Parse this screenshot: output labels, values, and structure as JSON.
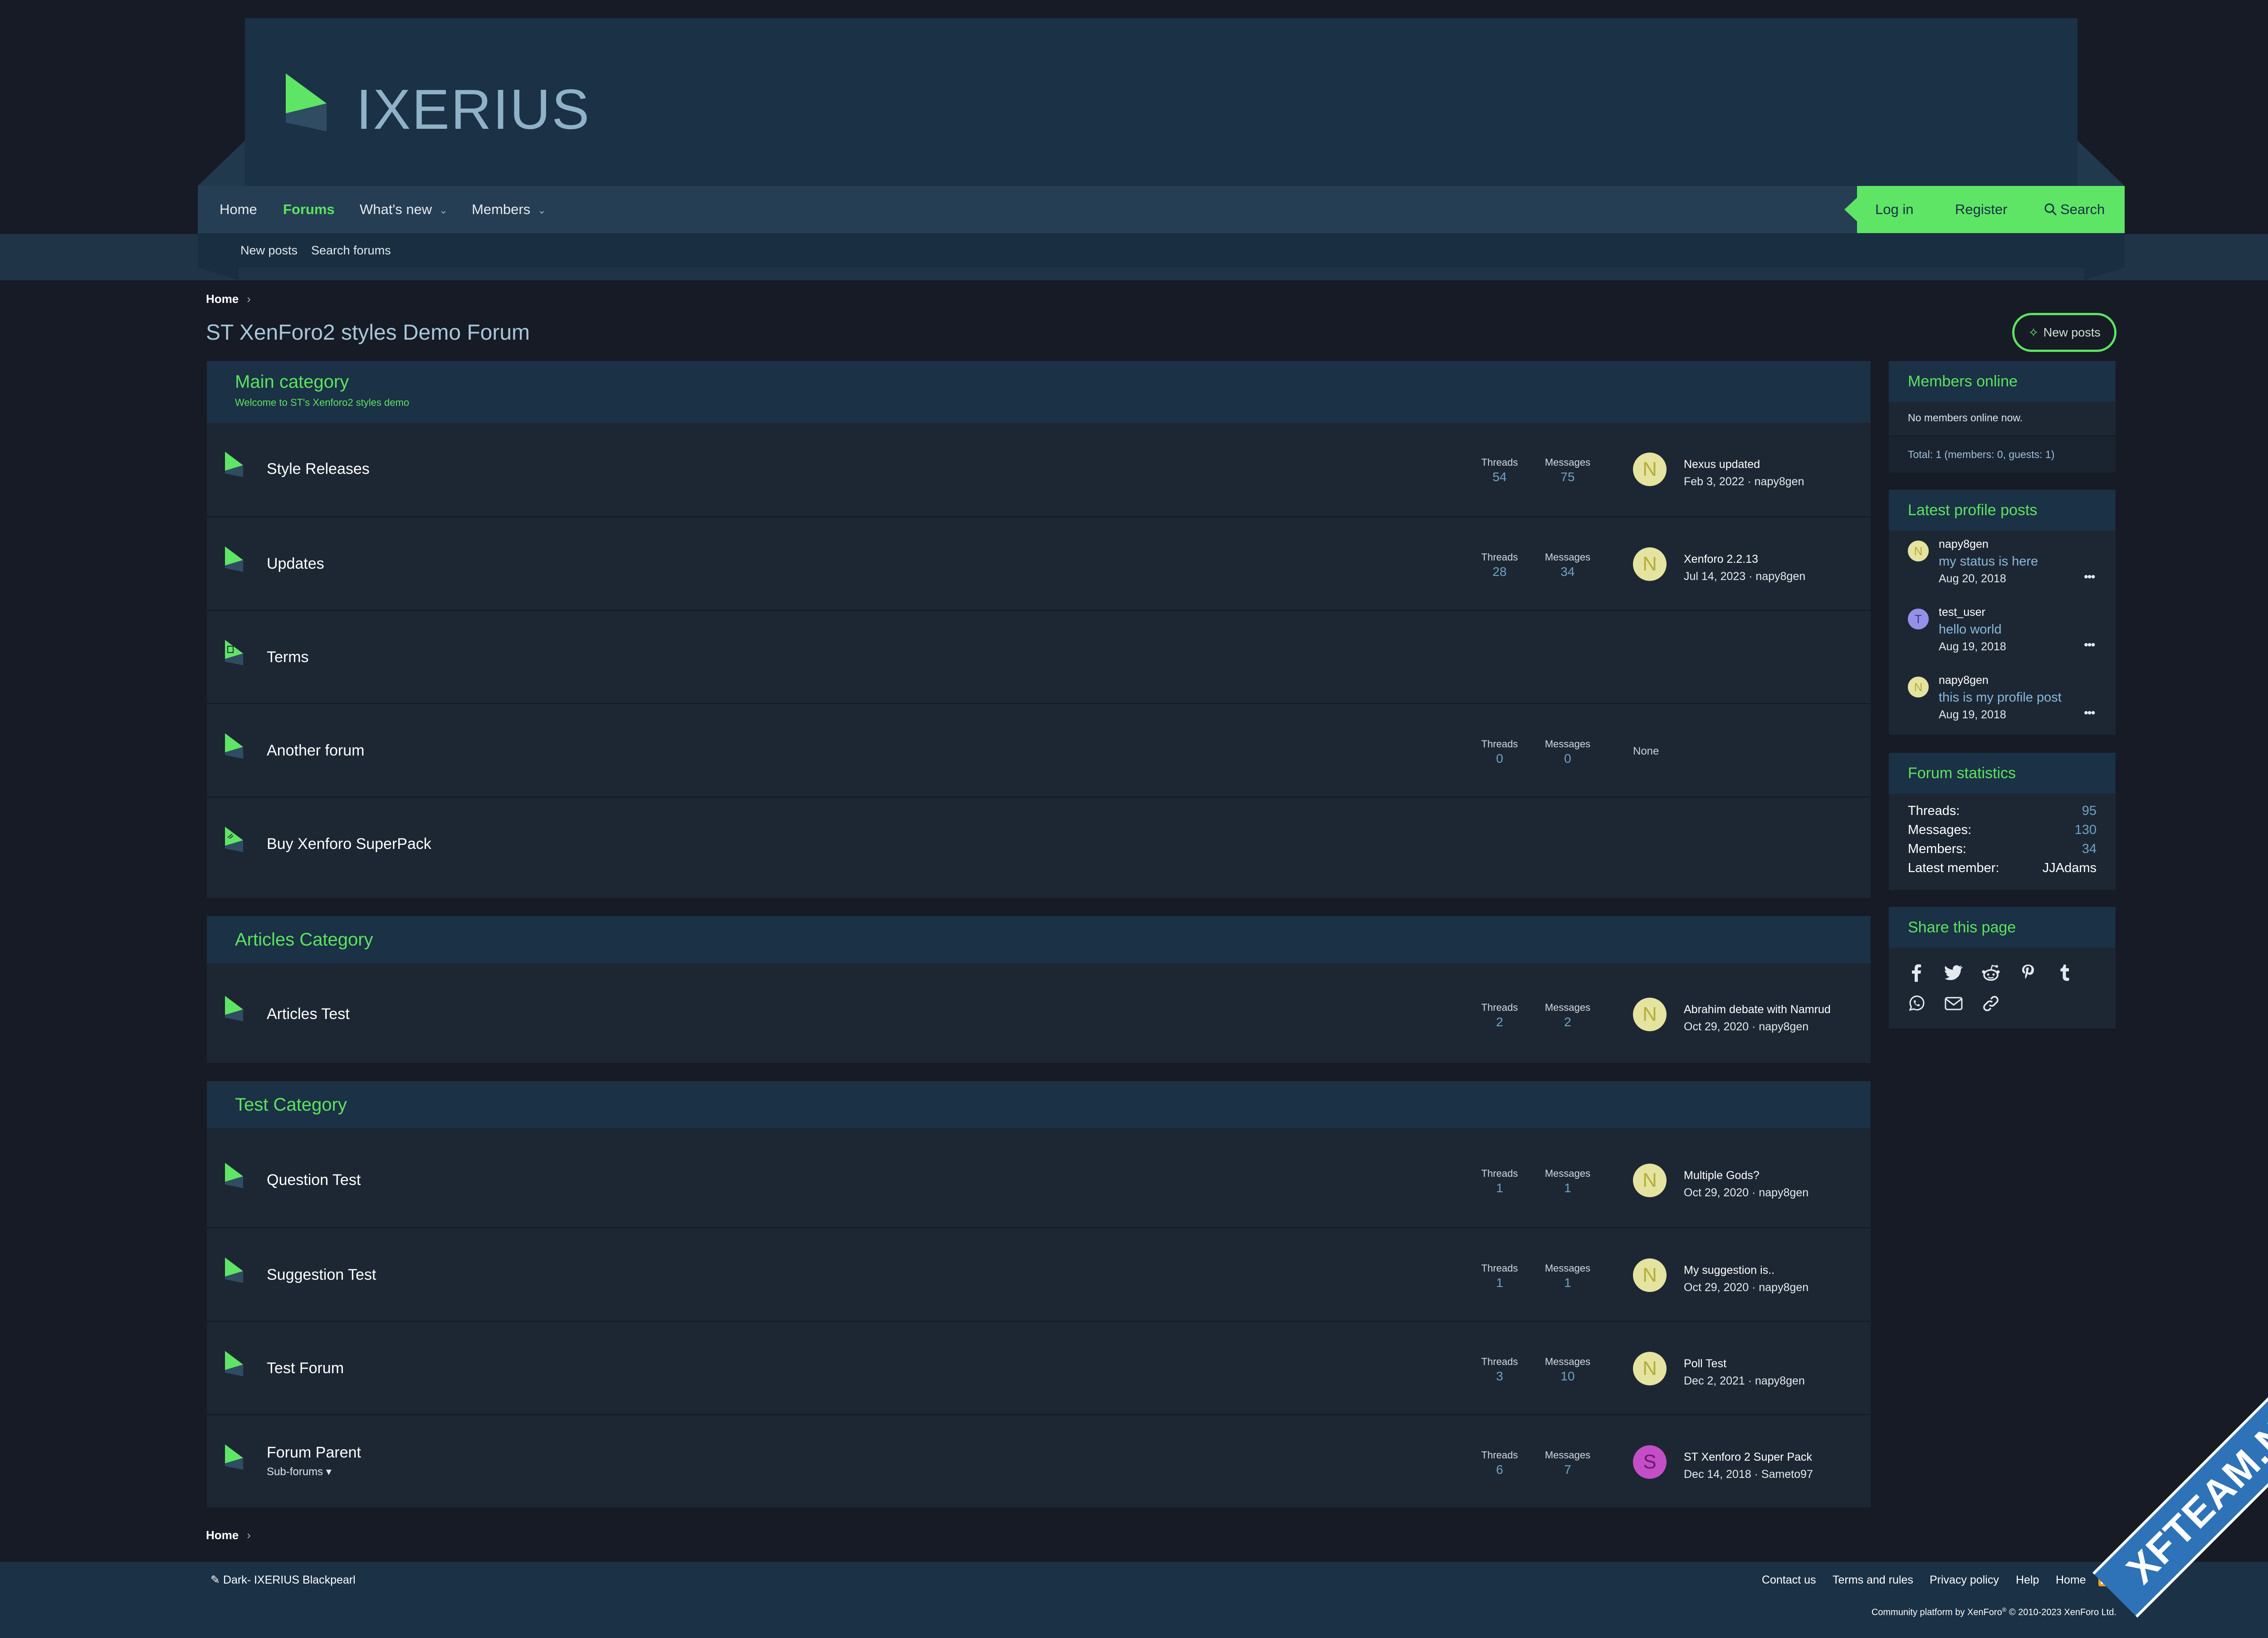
{
  "brand": {
    "logo_text": "IXERIUS"
  },
  "nav": {
    "items": [
      {
        "label": "Home"
      },
      {
        "label": "Forums"
      },
      {
        "label": "What's new"
      },
      {
        "label": "Members"
      }
    ],
    "login": "Log in",
    "register": "Register",
    "search": "Search",
    "sub_items": [
      {
        "label": "New posts"
      },
      {
        "label": "Search forums"
      }
    ]
  },
  "breadcrumb": {
    "home": "Home"
  },
  "page": {
    "title": "ST XenForo2 styles Demo Forum",
    "new_posts_button": "New posts"
  },
  "labels": {
    "threads": "Threads",
    "messages": "Messages",
    "none": "None",
    "sub_forums": "Sub-forums"
  },
  "categories": [
    {
      "title": "Main category",
      "description": "Welcome to ST's Xenforo2 styles demo",
      "forums": [
        {
          "title": "Style Releases",
          "threads": "54",
          "messages": "75",
          "avatar": "N",
          "last_title": "Nexus updated",
          "last_meta": "Feb 3, 2022 · napy8gen"
        },
        {
          "title": "Updates",
          "threads": "28",
          "messages": "34",
          "avatar": "N",
          "last_title": "Xenforo 2.2.13",
          "last_meta": "Jul 14, 2023 · napy8gen"
        },
        {
          "title": "Terms"
        },
        {
          "title": "Another forum",
          "threads": "0",
          "messages": "0"
        },
        {
          "title": "Buy Xenforo SuperPack"
        }
      ]
    },
    {
      "title": "Articles Category",
      "forums": [
        {
          "title": "Articles Test",
          "threads": "2",
          "messages": "2",
          "avatar": "N",
          "last_title": "Abrahim debate with Namrud",
          "last_meta": "Oct 29, 2020 · napy8gen"
        }
      ]
    },
    {
      "title": "Test Category",
      "forums": [
        {
          "title": "Question Test",
          "threads": "1",
          "messages": "1",
          "avatar": "N",
          "last_title": "Multiple Gods?",
          "last_meta": "Oct 29, 2020 · napy8gen"
        },
        {
          "title": "Suggestion Test",
          "threads": "1",
          "messages": "1",
          "avatar": "N",
          "last_title": "My suggestion is..",
          "last_meta": "Oct 29, 2020 · napy8gen"
        },
        {
          "title": "Test Forum",
          "threads": "3",
          "messages": "10",
          "avatar": "N",
          "last_title": "Poll Test",
          "last_meta": "Dec 2, 2021 · napy8gen"
        },
        {
          "title": "Forum Parent",
          "threads": "6",
          "messages": "7",
          "avatar": "S",
          "last_title": "ST Xenforo 2 Super Pack",
          "last_meta": "Dec 14, 2018 · Sameto97"
        }
      ]
    }
  ],
  "sidebar": {
    "members_online": {
      "title": "Members online",
      "text": "No members online now.",
      "total": "Total: 1 (members: 0, guests: 1)"
    },
    "profile_posts": {
      "title": "Latest profile posts",
      "posts": [
        {
          "avatar": "N",
          "user": "napy8gen",
          "message": "my status is here",
          "date": "Aug 20, 2018"
        },
        {
          "avatar": "T",
          "user": "test_user",
          "message": "hello world",
          "date": "Aug 19, 2018"
        },
        {
          "avatar": "N",
          "user": "napy8gen",
          "message": "this is my profile post",
          "date": "Aug 19, 2018"
        }
      ]
    },
    "statistics": {
      "title": "Forum statistics",
      "rows": [
        {
          "label": "Threads:",
          "value": "95"
        },
        {
          "label": "Messages:",
          "value": "130"
        },
        {
          "label": "Members:",
          "value": "34"
        },
        {
          "label": "Latest member:",
          "value": "JJAdams"
        }
      ]
    },
    "share": {
      "title": "Share this page",
      "icons": [
        "facebook-icon",
        "twitter-icon",
        "reddit-icon",
        "pinterest-icon",
        "tumblr-icon",
        "whatsapp-icon",
        "email-icon",
        "link-icon"
      ]
    }
  },
  "footer": {
    "style_chooser": "Dark- IXERIUS Blackpearl",
    "links": [
      {
        "label": "Contact us"
      },
      {
        "label": "Terms and rules"
      },
      {
        "label": "Privacy policy"
      },
      {
        "label": "Help"
      },
      {
        "label": "Home"
      }
    ],
    "copyright_prefix": "Community platform by XenForo",
    "copyright_reg": "®",
    "copyright_suffix": " © 2010-2023 XenForo Ltd."
  },
  "watermark": "XFTEAM.NET",
  "colors": {
    "accent": "#5ce35f",
    "header": "#1b3145",
    "nav": "#263e53",
    "background": "#161b25",
    "panel": "#1d2733"
  }
}
